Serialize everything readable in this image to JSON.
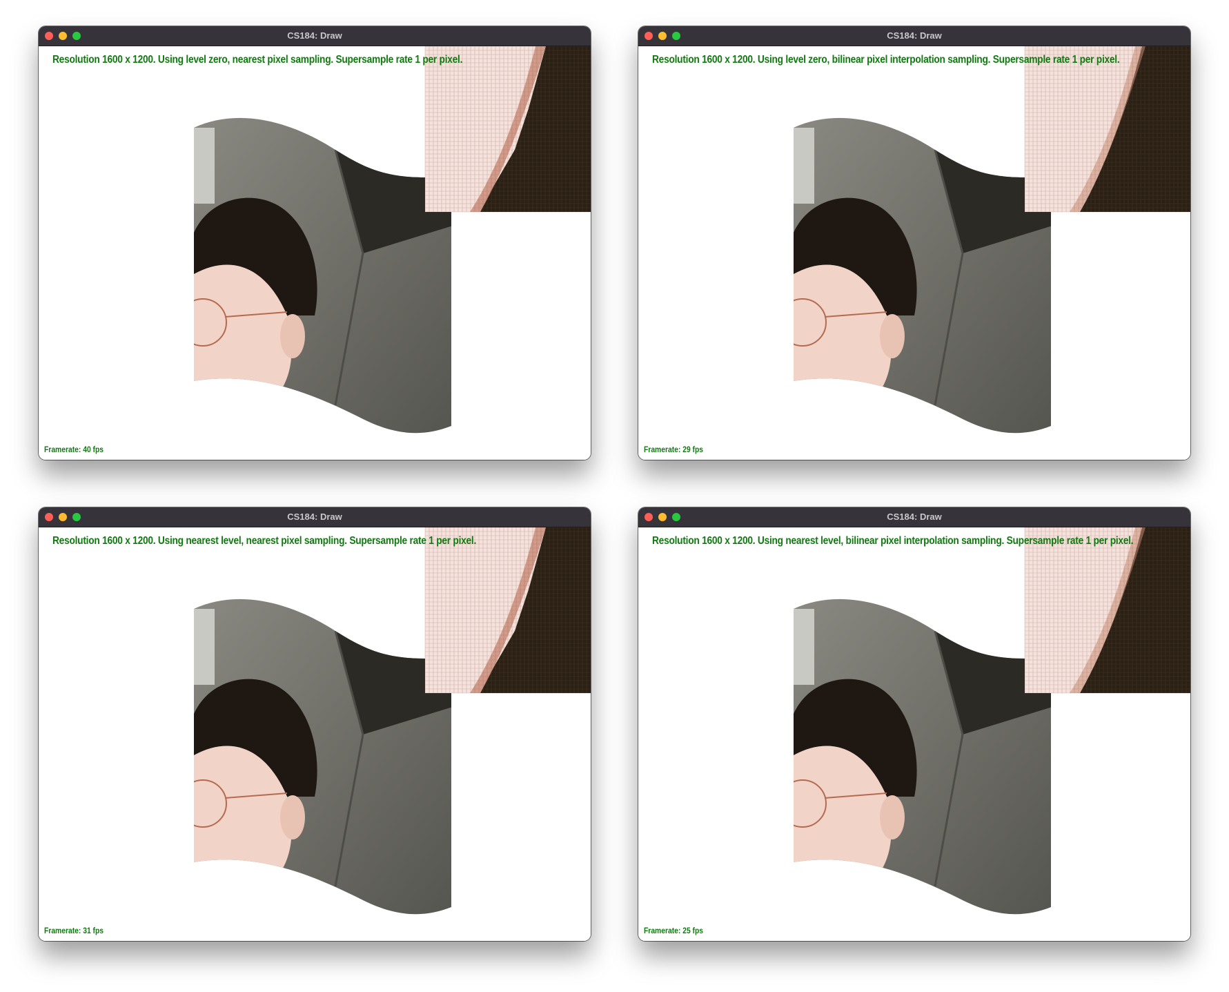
{
  "windows": [
    {
      "title": "CS184: Draw",
      "status": "Resolution 1600 x 1200. Using level zero, nearest pixel sampling. Supersample rate 1 per pixel.",
      "framerate": "Framerate: 40 fps"
    },
    {
      "title": "CS184: Draw",
      "status": "Resolution 1600 x 1200. Using level zero, bilinear pixel interpolation sampling. Supersample rate 1 per pixel.",
      "framerate": "Framerate: 29 fps"
    },
    {
      "title": "CS184: Draw",
      "status": "Resolution 1600 x 1200. Using nearest level, nearest pixel sampling. Supersample rate 1 per pixel.",
      "framerate": "Framerate: 31 fps"
    },
    {
      "title": "CS184: Draw",
      "status": "Resolution 1600 x 1200. Using nearest level, bilinear pixel interpolation sampling. Supersample rate 1 per pixel.",
      "framerate": "Framerate: 25 fps"
    }
  ],
  "colors": {
    "status_text": "#117a11",
    "titlebar": "#37333a",
    "wall": "#6f6e68",
    "hair": "#1e1712",
    "skin": "#f2d3c8",
    "zoom_skin": "#f6e2dc",
    "zoom_dark": "#2a2114"
  },
  "icons": [
    "close-dot-icon",
    "minimize-dot-icon",
    "maximize-dot-icon"
  ]
}
